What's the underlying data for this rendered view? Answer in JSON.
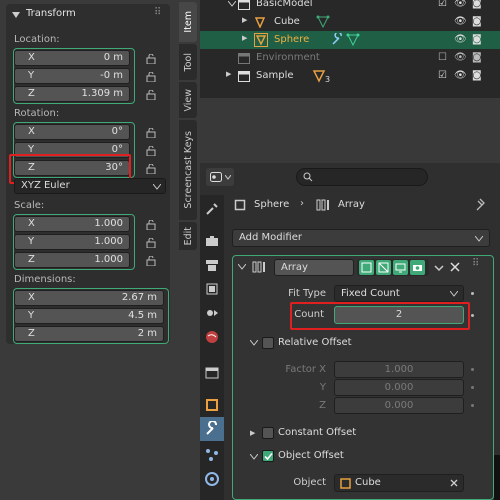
{
  "npanel": {
    "title": "Transform",
    "location_label": "Location:",
    "location": [
      {
        "axis": "X",
        "value": "0 m"
      },
      {
        "axis": "Y",
        "value": "-0 m"
      },
      {
        "axis": "Z",
        "value": "1.309 m"
      }
    ],
    "rotation_label": "Rotation:",
    "rotation": [
      {
        "axis": "X",
        "value": "0°"
      },
      {
        "axis": "Y",
        "value": "0°"
      },
      {
        "axis": "Z",
        "value": "30°"
      }
    ],
    "rotation_mode": "XYZ Euler",
    "scale_label": "Scale:",
    "scale": [
      {
        "axis": "X",
        "value": "1.000"
      },
      {
        "axis": "Y",
        "value": "1.000"
      },
      {
        "axis": "Z",
        "value": "1.000"
      }
    ],
    "dimensions_label": "Dimensions:",
    "dimensions": [
      {
        "axis": "X",
        "value": "2.67 m"
      },
      {
        "axis": "Y",
        "value": "4.5 m"
      },
      {
        "axis": "Z",
        "value": "2 m"
      }
    ]
  },
  "tabs": [
    "Item",
    "Tool",
    "View",
    "Screencast Keys",
    "Edit"
  ],
  "outliner": {
    "rows": [
      {
        "name": "BasicModel"
      },
      {
        "name": "Cube"
      },
      {
        "name": "Sphere"
      },
      {
        "name": "Environment"
      },
      {
        "name": "Sample",
        "badge": "3"
      }
    ]
  },
  "props": {
    "breadcrumb_object": "Sphere",
    "breadcrumb_modifier": "Array",
    "add_modifier": "Add Modifier",
    "modifier_name": "Array",
    "fit_type_label": "Fit Type",
    "fit_type_value": "Fixed Count",
    "count_label": "Count",
    "count_value": "2",
    "relative_offset_label": "Relative Offset",
    "factor_x_label": "Factor X",
    "y_label": "Y",
    "z_label": "Z",
    "factor_x": "1.000",
    "factor_y": "0.000",
    "factor_z": "0.000",
    "constant_offset_label": "Constant Offset",
    "object_offset_label": "Object Offset",
    "object_label": "Object",
    "object_value": "Cube"
  },
  "colors": {
    "accent": "#3fa978",
    "highlight": "#e02020",
    "selected_row": "#1f5f45"
  }
}
